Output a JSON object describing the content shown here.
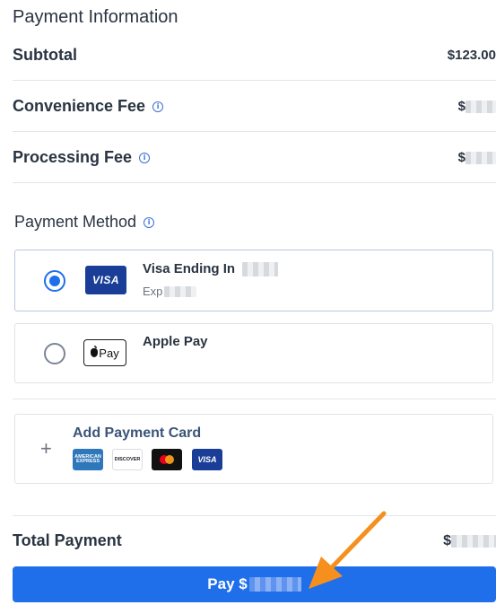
{
  "page_title": "Payment Information",
  "summary": {
    "subtotal_label": "Subtotal",
    "subtotal_value": "$123.00",
    "convenience_fee_label": "Convenience Fee",
    "convenience_fee_value": "$",
    "processing_fee_label": "Processing Fee",
    "processing_fee_value": "$"
  },
  "payment_method": {
    "title": "Payment Method",
    "options": [
      {
        "brand": "VISA",
        "title": "Visa Ending In",
        "sub": "Exp",
        "selected": true
      },
      {
        "brand": "Pay",
        "title": "Apple Pay",
        "selected": false
      }
    ],
    "add_card_label": "Add Payment Card",
    "add_card_icon": "plus-icon",
    "accepted_cards": [
      {
        "name": "amex",
        "text": "AMERICAN EXPRESS"
      },
      {
        "name": "discover",
        "text": "DISCOVER"
      },
      {
        "name": "mastercard",
        "text": ""
      },
      {
        "name": "visa",
        "text": "VISA"
      }
    ]
  },
  "total": {
    "label": "Total Payment",
    "value": "$"
  },
  "pay_button_label": "Pay $",
  "colors": {
    "primary": "#1f6feb",
    "visa_blue": "#1a3e98",
    "arrow": "#f5901e"
  }
}
